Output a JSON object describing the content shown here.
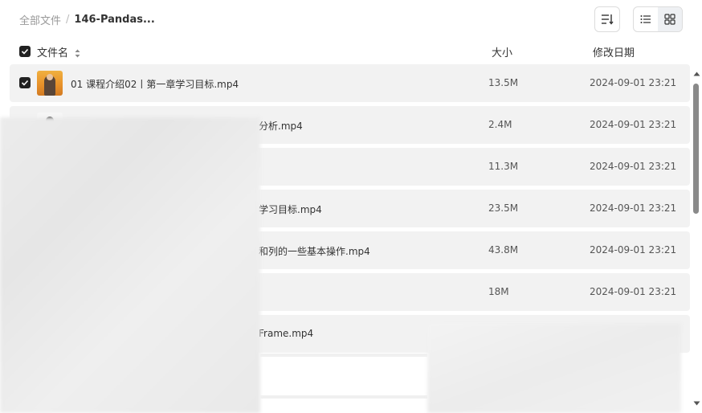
{
  "breadcrumb": {
    "root": "全部文件",
    "separator": "/",
    "current": "146-Pandas..."
  },
  "toolbar": {
    "sort_icon": "sort-list-icon",
    "list_view_icon": "list-view-icon",
    "grid_view_icon": "grid-view-icon",
    "active_view": "list"
  },
  "header": {
    "name": "文件名",
    "size": "大小",
    "date": "修改日期"
  },
  "rows": [
    {
      "name": "01 课程介绍02丨第一章学习目标.mp4",
      "size": "13.5M",
      "date": "2024-09-01 23:21",
      "checked": true
    },
    {
      "name": "分析.mp4",
      "size": "2.4M",
      "date": "2024-09-01 23:21",
      "checked": false
    },
    {
      "name": "",
      "size": "11.3M",
      "date": "2024-09-01 23:21",
      "checked": false
    },
    {
      "name": "学习目标.mp4",
      "size": "23.5M",
      "date": "2024-09-01 23:21",
      "checked": false
    },
    {
      "name": "和列的一些基本操作.mp4",
      "size": "43.8M",
      "date": "2024-09-01 23:21",
      "checked": false
    },
    {
      "name": "",
      "size": "18M",
      "date": "2024-09-01 23:21",
      "checked": false
    },
    {
      "name": "Frame.mp4",
      "size": "",
      "date": "",
      "checked": false
    }
  ],
  "colors": {
    "row_bg": "#f2f2f2",
    "checkbox": "#222222",
    "scroll_thumb": "#8a8a8a"
  }
}
